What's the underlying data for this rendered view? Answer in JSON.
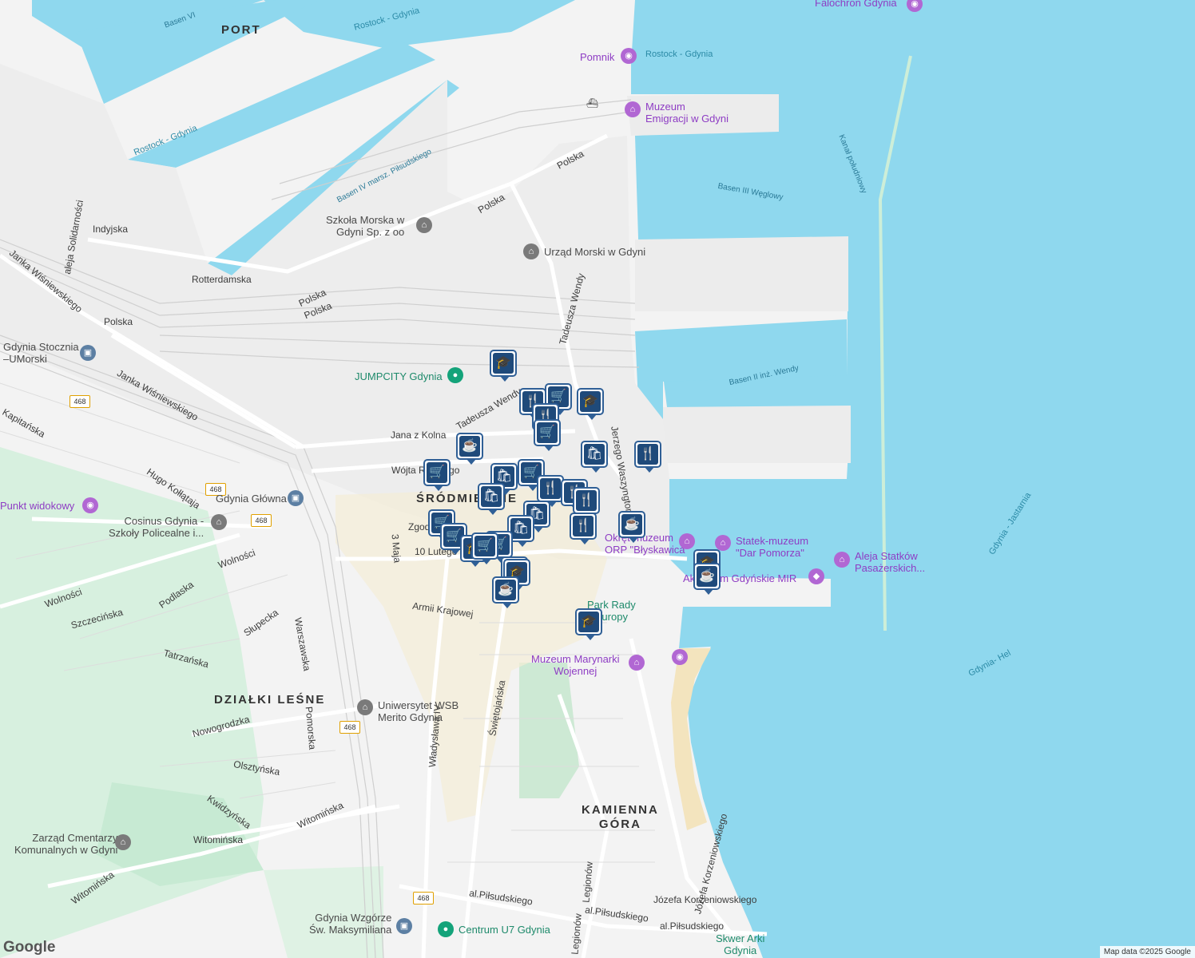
{
  "map": {
    "attribution": "Map data ©2025 Google",
    "logo": "Google"
  },
  "districts": {
    "port": "PORT",
    "srodmiescie": "ŚRÓDMIEŚCIE",
    "dzialki_lesne": "DZIAŁKI LEŚNE",
    "kamienna_gora": "KAMIENNA\nGÓRA"
  },
  "water_labels": {
    "basen_vi": "Basen VI",
    "basen_iv": "Basen IV marsz. Piłsudskiego",
    "basen_iii": "Basen III Węglowy",
    "basen_ii": "Basen II inż. Wendy",
    "kanal": "Kanał południowy"
  },
  "ferry_routes": {
    "rostock_1": "Rostock - Gdynia",
    "rostock_2": "Rostock - Gdynia",
    "rostock_3": "Rostock - Gdynia",
    "jastarnia": "Gdynia - Jastarnia",
    "hel": "Gdynia- Hel"
  },
  "streets": {
    "polska_1": "Polska",
    "polska_2": "Polska",
    "polska_3": "Polska",
    "polska_4": "Polska",
    "polska_5": "Polska",
    "indyjska": "Indyjska",
    "rotterdamska": "Rotterdamska",
    "solidarnosci": "aleja Solidarności",
    "wisniewskiego_1": "Janka Wiśniewskiego",
    "wisniewskiego_2": "Janka Wiśniewskiego",
    "wendy_1": "Tadeusza Wendy",
    "wendy_2": "Tadeusza Wendy",
    "jana_z_kolna": "Jana z Kolna",
    "wojta": "Wójta Radtkego",
    "kapitanska": "Kapitańska",
    "kollataja": "Hugo Kołłątaja",
    "wolnosci_1": "Wolności",
    "wolnosci_2": "Wolności",
    "podlaska": "Podlaska",
    "szczecinska": "Szczecińska",
    "slupecka": "Słupecka",
    "tatrzanska": "Tatrzańska",
    "warszawska": "Warszawska",
    "trzy_maja": "3 Maja",
    "zgody": "Zgody",
    "dziesiatego_lutego": "10 Lutego",
    "armii_krajowej": "Armii Krajowej",
    "nowogrodzka": "Nowogrodzka",
    "pomorska": "Pomorska",
    "olsztynska": "Olsztyńska",
    "kwidzynska": "Kwidzyńska",
    "witominska_1": "Witomińska",
    "witominska_2": "Witomińska",
    "witominska_3": "Witomińska",
    "wladyslawa": "Władysława IV",
    "swietojanska": "Świętojańska",
    "pilsudskiego_1": "al.Piłsudskiego",
    "pilsudskiego_2": "al.Piłsudskiego",
    "pilsudskiego_3": "al.Piłsudskiego",
    "legionow_1": "Legionów",
    "legionow_2": "Legionów",
    "korzeniowskiego_1": "Józefa Korzeniowskiego",
    "korzeniowskiego_2": "Józefa Korzeniowskiego",
    "waszyngtona": "Jerzego Waszyngtona"
  },
  "road_shields": {
    "s1": "468",
    "s2": "468",
    "s3": "468",
    "s4": "468",
    "s5": "468"
  },
  "pois": {
    "falochron": "Falochron Gdynia",
    "pomnik": "Pomnik",
    "muzeum_emigracji": "Muzeum\nEmigracji w Gdyni",
    "szkola_morska": "Szkoła Morska w\nGdyni Sp. z oo",
    "urzad_morski": "Urząd Morski w Gdyni",
    "jumpcity": "JUMPCITY Gdynia",
    "gdynia_stocznia": "Gdynia Stocznia\n–UMorski",
    "gdynia_glowna": "Gdynia Główna",
    "punkt_widokowy": "Punkt widokowy",
    "cosinus": "Cosinus Gdynia -\nSzkoły Policealne i...",
    "okretowe_muzeum": "Okręt-muzeum\nORP \"Błyskawica\"",
    "statek_muzeum": "Statek-muzeum\n\"Dar Pomorza\"",
    "aleja_statkow": "Aleja Statków\nPasażerskich...",
    "akwarium": "Akwarium Gdyńskie MIR",
    "park_rady": "Park Rady\nEuropy",
    "muzeum_marynarki": "Muzeum Marynarki\nWojennej",
    "uniwersytet": "Uniwersytet WSB\nMerito Gdynia",
    "zarzad_cmentarzy": "Zarząd Cmentarzy\nKomunalnych w Gdyni",
    "gdynia_wzgorze": "Gdynia Wzgórze\nŚw. Maksymiliana",
    "centrum_u7": "Centrum U7 Gdynia",
    "skwer_arki": "Skwer Arki\nGdynia"
  },
  "markers": [
    {
      "type": "education",
      "glyph": "🎓"
    },
    {
      "type": "restaurant",
      "glyph": "🍴"
    },
    {
      "type": "grocery",
      "glyph": "🛒"
    },
    {
      "type": "education",
      "glyph": "🎓"
    },
    {
      "type": "restaurant",
      "glyph": "🍴"
    },
    {
      "type": "grocery",
      "glyph": "🛒"
    },
    {
      "type": "shopping",
      "glyph": "🛍"
    },
    {
      "type": "restaurant",
      "glyph": "🍴"
    },
    {
      "type": "cafe",
      "glyph": "☕"
    },
    {
      "type": "grocery",
      "glyph": "🛒"
    },
    {
      "type": "shopping",
      "glyph": "🛍"
    },
    {
      "type": "grocery",
      "glyph": "🛒"
    },
    {
      "type": "restaurant",
      "glyph": "🍴"
    },
    {
      "type": "restaurant",
      "glyph": "🍴"
    },
    {
      "type": "restaurant",
      "glyph": "🍴"
    },
    {
      "type": "shopping",
      "glyph": "🛍"
    },
    {
      "type": "shopping",
      "glyph": "🛍"
    },
    {
      "type": "restaurant",
      "glyph": "🍴"
    },
    {
      "type": "cafe",
      "glyph": "☕"
    },
    {
      "type": "grocery",
      "glyph": "🛒"
    },
    {
      "type": "shopping",
      "glyph": "🛍"
    },
    {
      "type": "grocery",
      "glyph": "🛒"
    },
    {
      "type": "grocery",
      "glyph": "🛒"
    },
    {
      "type": "education",
      "glyph": "🎓"
    },
    {
      "type": "grocery",
      "glyph": "🛒"
    },
    {
      "type": "education",
      "glyph": "🎓"
    },
    {
      "type": "education",
      "glyph": "🎓"
    },
    {
      "type": "cafe",
      "glyph": "☕"
    },
    {
      "type": "education",
      "glyph": "🎓"
    },
    {
      "type": "cafe",
      "glyph": "☕"
    },
    {
      "type": "education",
      "glyph": "🎓"
    }
  ]
}
